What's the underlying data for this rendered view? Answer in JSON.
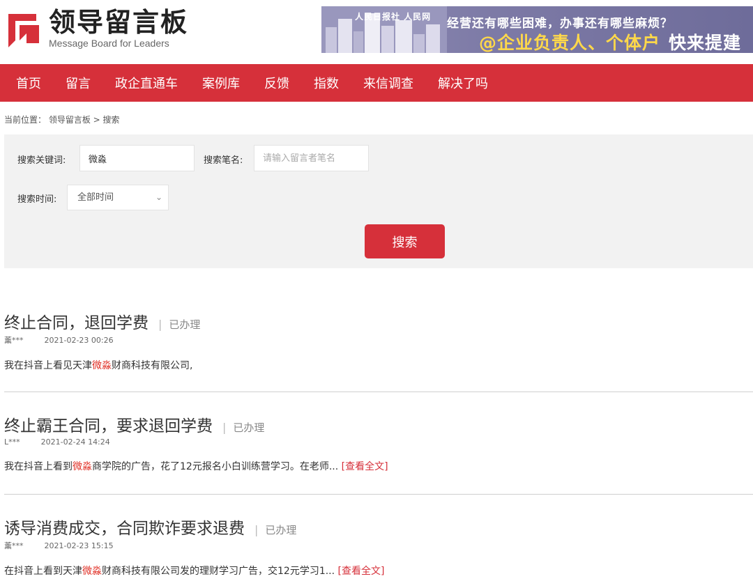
{
  "header": {
    "logo_cn": "领导留言板",
    "logo_en": "Message Board for Leaders",
    "banner": {
      "logos": "人民日报社  人民网",
      "line1": "经营还有哪些困难，办事还有哪些麻烦？",
      "line2_highlight": "@企业负责人、个体户",
      "line2_cta": "快来提建议"
    }
  },
  "nav": {
    "items": [
      "首页",
      "留言",
      "政企直通车",
      "案例库",
      "反馈",
      "指数",
      "来信调查",
      "解决了吗"
    ]
  },
  "breadcrumb": "当前位置： 领导留言板 > 搜索",
  "search": {
    "keyword_label": "搜索关键词:",
    "keyword_value": "微淼",
    "author_label": "搜索笔名:",
    "author_placeholder": "请输入留言者笔名",
    "time_label": "搜索时间:",
    "time_value": "全部时间",
    "submit_label": "搜索"
  },
  "results": [
    {
      "title": "终止合同，退回学费",
      "separator": "|",
      "status": "已办理",
      "author": "薰***",
      "time": "2021-02-23 00:26",
      "body_pre": "我在抖音上看见天津",
      "body_hl": "微淼",
      "body_post": "财商科技有限公司,",
      "more": ""
    },
    {
      "title": "终止霸王合同，要求退回学费",
      "separator": "|",
      "status": "已办理",
      "author": "L***",
      "time": "2021-02-24 14:24",
      "body_pre": "我在抖音上看到",
      "body_hl": "微淼",
      "body_post": "商学院的广告，花了12元报名小白训练营学习。在老师... ",
      "more": "[查看全文]"
    },
    {
      "title": "诱导消费成交，合同欺诈要求退费",
      "separator": "|",
      "status": "已办理",
      "author": "薰***",
      "time": "2021-02-23 15:15",
      "body_pre": "在抖音上看到天津",
      "body_hl": "微淼",
      "body_post": "财商科技有限公司发的理财学习广告，交12元学习1... ",
      "more": "[查看全文]"
    }
  ],
  "colors": {
    "brand_red": "#d6303a",
    "highlight": "#e02e24",
    "panel_bg": "#f2f2f2"
  }
}
